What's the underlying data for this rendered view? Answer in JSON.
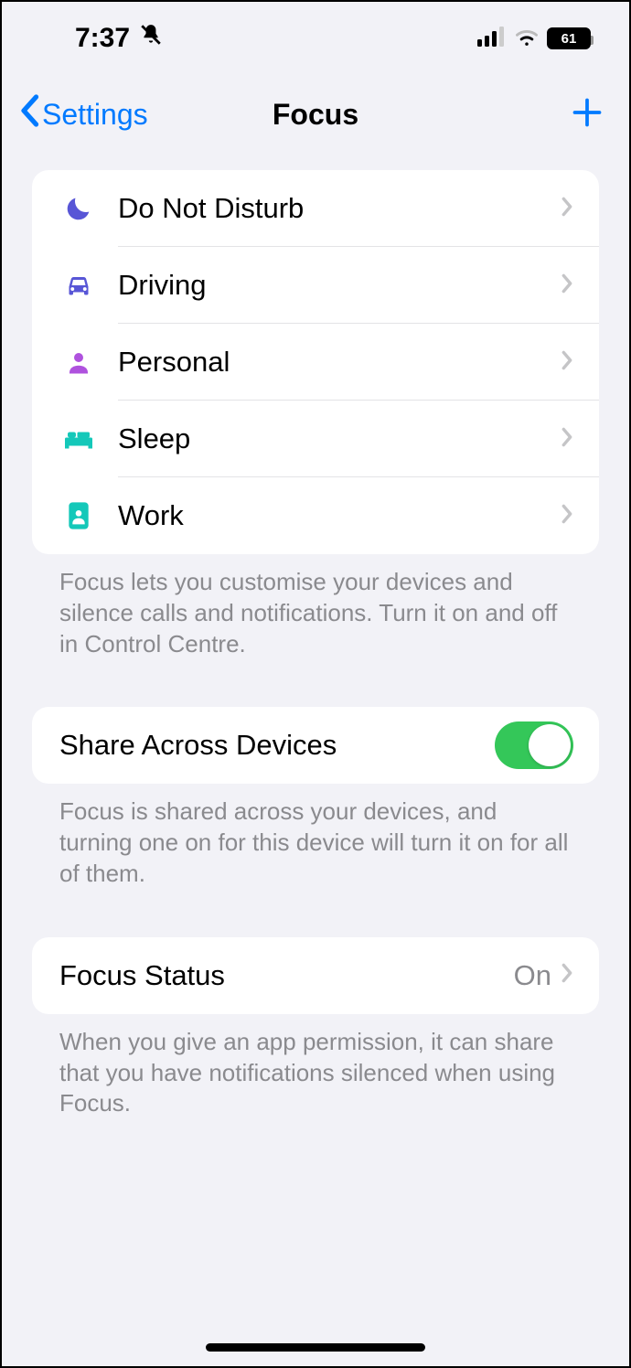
{
  "status": {
    "time": "7:37",
    "battery": "61"
  },
  "nav": {
    "back_label": "Settings",
    "title": "Focus"
  },
  "focus_modes": [
    {
      "label": "Do Not Disturb",
      "icon": "moon",
      "color": "#5856d6"
    },
    {
      "label": "Driving",
      "icon": "car",
      "color": "#5856d6"
    },
    {
      "label": "Personal",
      "icon": "person",
      "color": "#af52de"
    },
    {
      "label": "Sleep",
      "icon": "bed",
      "color": "#14c8b9"
    },
    {
      "label": "Work",
      "icon": "badge",
      "color": "#14c8b9"
    }
  ],
  "focus_footer": "Focus lets you customise your devices and silence calls and notifications. Turn it on and off in Control Centre.",
  "share": {
    "label": "Share Across Devices",
    "enabled": true,
    "footer": "Focus is shared across your devices, and turning one on for this device will turn it on for all of them."
  },
  "focus_status": {
    "label": "Focus Status",
    "value": "On",
    "footer": "When you give an app permission, it can share that you have notifications silenced when using Focus."
  }
}
